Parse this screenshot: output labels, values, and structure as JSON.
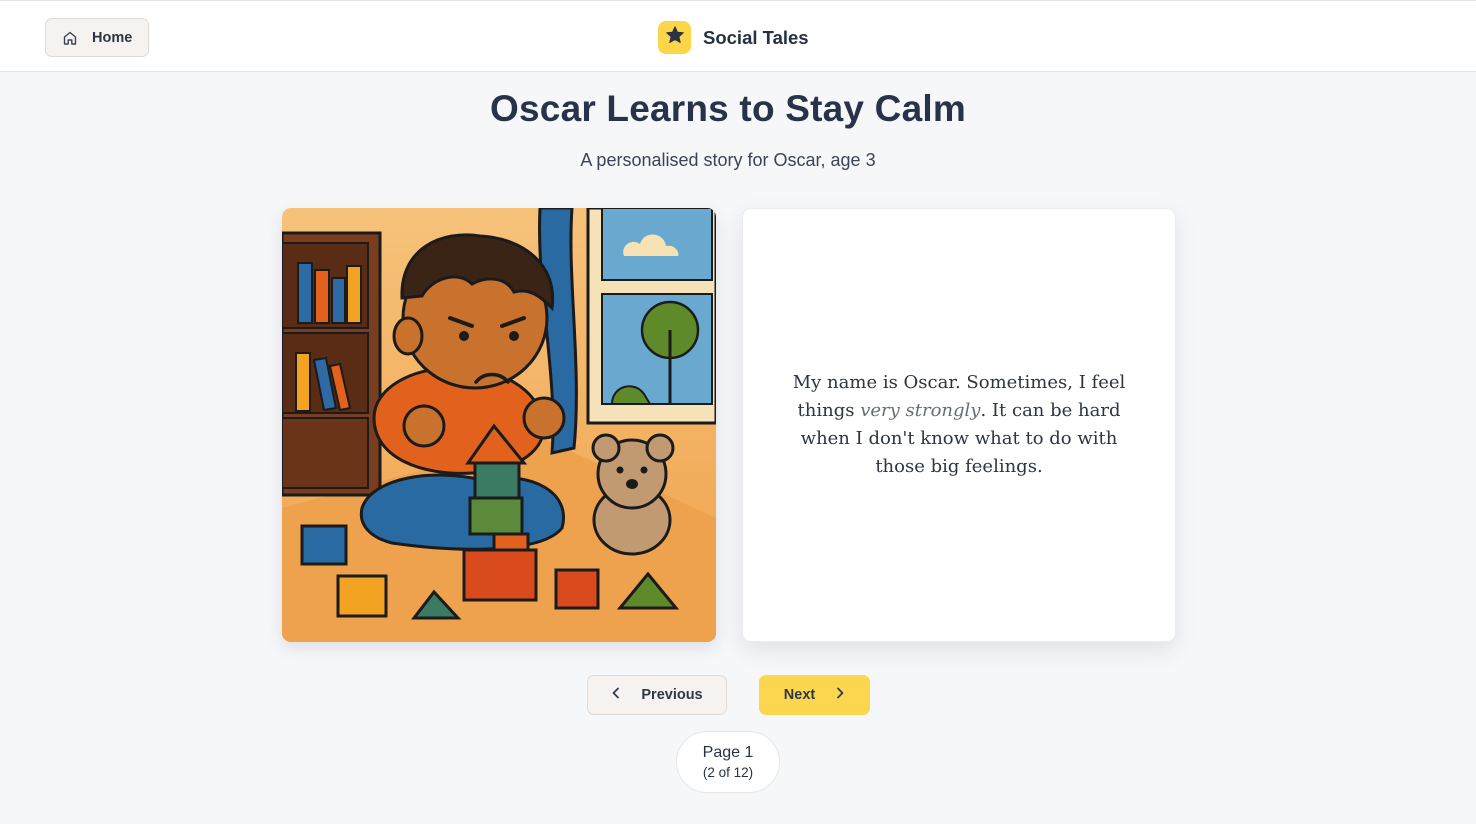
{
  "header": {
    "home_label": "Home",
    "brand_name": "Social Tales",
    "brand_color": "#fcd648"
  },
  "story": {
    "title": "Oscar Learns to Stay Calm",
    "subtitle": "A personalised story for Oscar, age 3",
    "text_before": "My name is Oscar. Sometimes, I feel things ",
    "text_emphasis": "very strongly",
    "text_after": ". It can be hard when I don't know what to do with those big feelings."
  },
  "navigation": {
    "previous_label": "Previous",
    "next_label": "Next",
    "next_color": "#fdd64f",
    "page_label": "Page 1",
    "page_count": "(2 of 12)"
  },
  "icons": {
    "home": "home-icon",
    "brand": "star-icon",
    "previous": "chevron-left-icon",
    "next": "chevron-right-icon"
  }
}
